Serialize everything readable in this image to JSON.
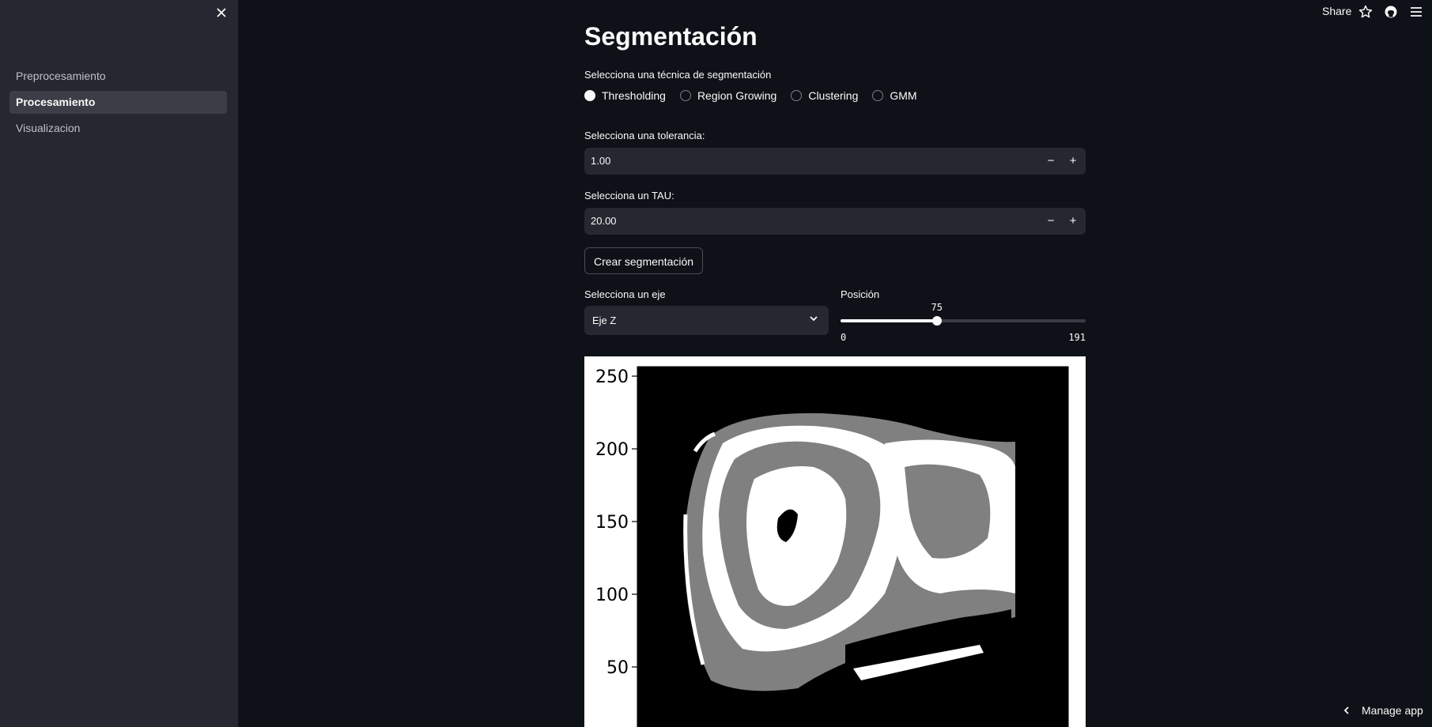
{
  "sidebar": {
    "close_icon": "close-icon",
    "items": [
      {
        "label": "Preprocesamiento",
        "active": false
      },
      {
        "label": "Procesamiento",
        "active": true
      },
      {
        "label": "Visualizacion",
        "active": false
      }
    ]
  },
  "toolbar": {
    "share_label": "Share",
    "icons": [
      "star-icon",
      "github-icon",
      "menu-icon"
    ]
  },
  "main": {
    "title": "Segmentación",
    "technique": {
      "label": "Selecciona una técnica de segmentación",
      "options": [
        "Thresholding",
        "Region Growing",
        "Clustering",
        "GMM"
      ],
      "selected": "Thresholding"
    },
    "tolerance": {
      "label": "Selecciona una tolerancia:",
      "value": "1.00",
      "minus": "−",
      "plus": "+"
    },
    "tau": {
      "label": "Selecciona un TAU:",
      "value": "20.00",
      "minus": "−",
      "plus": "+"
    },
    "create_button": "Crear segmentación",
    "axis": {
      "label": "Selecciona un eje",
      "value": "Eje Z"
    },
    "position": {
      "label": "Posición",
      "value": 75,
      "min": 0,
      "max": 191,
      "value_label": "75",
      "min_label": "0",
      "max_label": "191"
    }
  },
  "chart_data": {
    "type": "heatmap",
    "description_free": true,
    "yticks": [
      250,
      200,
      150,
      100,
      50
    ],
    "tick_labels": [
      "250",
      "200",
      "150",
      "100",
      "50"
    ],
    "colormap": [
      "#000000",
      "#808080",
      "#ffffff"
    ]
  },
  "footer": {
    "manage_label": "Manage app"
  },
  "colors": {
    "background": "#0e1117",
    "sidebar": "#262730",
    "input": "#262730",
    "text": "#fafafa"
  }
}
